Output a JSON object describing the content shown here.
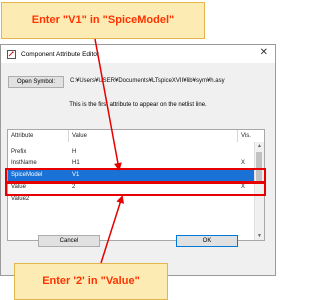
{
  "callouts": {
    "top": "Enter \"V1\" in \"SpiceModel\"",
    "bottom": "Enter '2' in \"Value\""
  },
  "window": {
    "title": "Component Attribute Editor",
    "close_glyph": "✕",
    "open_symbol_label": "Open Symbol:",
    "symbol_path": "C:¥Users¥USER¥Documents¥LTspiceXVII¥lib¥sym¥h.asy",
    "info_text": "This is the first attribute to appear on the netlist line."
  },
  "table": {
    "headers": [
      "Attribute",
      "Value",
      "Vis."
    ],
    "rows": [
      {
        "attribute": "Prefix",
        "value": "H",
        "vis": ""
      },
      {
        "attribute": "InstName",
        "value": "H1",
        "vis": "X"
      },
      {
        "attribute": "SpiceModel",
        "value": "V1",
        "vis": ""
      },
      {
        "attribute": "Value",
        "value": "2",
        "vis": "X"
      },
      {
        "attribute": "Value2",
        "value": "",
        "vis": ""
      }
    ]
  },
  "buttons": {
    "cancel": "Cancel",
    "ok": "OK"
  },
  "colors": {
    "selection": "#1a72d6",
    "highlight": "#e60000",
    "callout_bg": "#fdebb4",
    "callout_text": "#ff3300"
  },
  "icons": {
    "title": "component-editor-icon",
    "close": "close-icon",
    "scroll_up": "scroll-up-icon",
    "scroll_down": "scroll-down-icon"
  }
}
